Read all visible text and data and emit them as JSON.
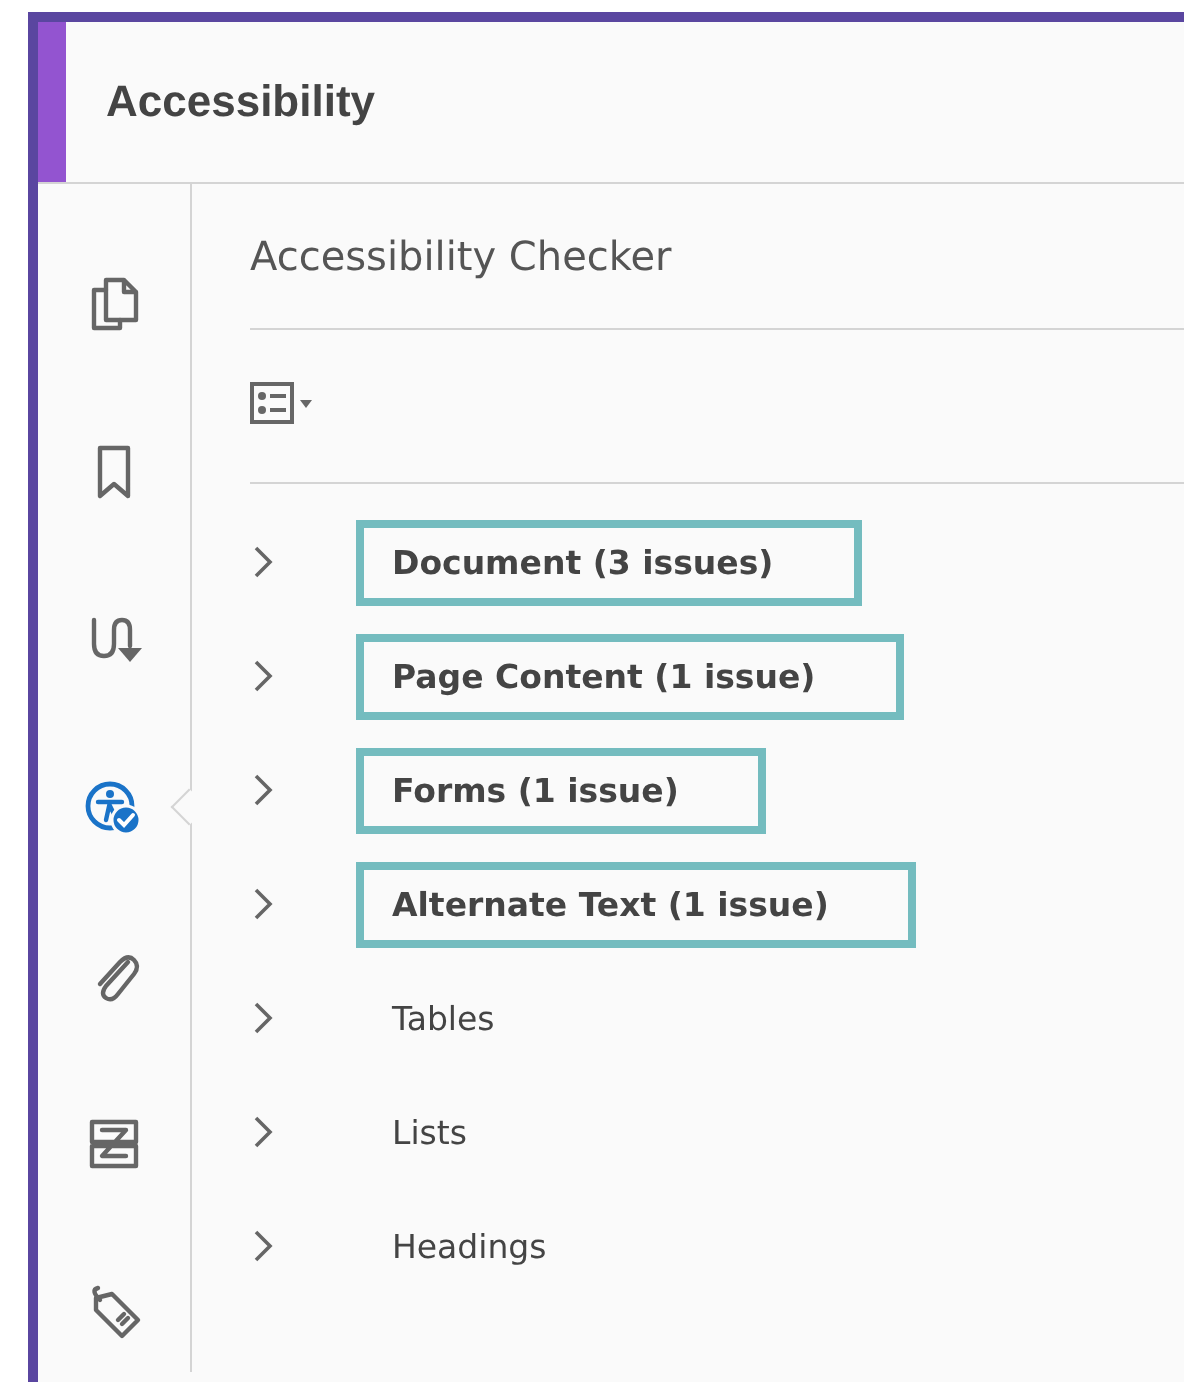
{
  "panel": {
    "title": "Accessibility"
  },
  "rail": [
    {
      "kind": "pages",
      "selected": false
    },
    {
      "kind": "bookmark",
      "selected": false
    },
    {
      "kind": "order",
      "selected": false
    },
    {
      "kind": "accessibility",
      "selected": true
    },
    {
      "kind": "attachment",
      "selected": false
    },
    {
      "kind": "content",
      "selected": false
    },
    {
      "kind": "tag",
      "selected": false
    }
  ],
  "checker": {
    "title": "Accessibility Checker",
    "items": [
      {
        "label": "Document (3 issues)",
        "highlighted": true,
        "expanded": false
      },
      {
        "label": "Page Content (1 issue)",
        "highlighted": true,
        "expanded": false
      },
      {
        "label": "Forms (1 issue)",
        "highlighted": true,
        "expanded": false
      },
      {
        "label": "Alternate Text (1 issue)",
        "highlighted": true,
        "expanded": false
      },
      {
        "label": "Tables",
        "highlighted": false,
        "expanded": false
      },
      {
        "label": "Lists",
        "highlighted": false,
        "expanded": false
      },
      {
        "label": "Headings",
        "highlighted": false,
        "expanded": false
      }
    ]
  }
}
